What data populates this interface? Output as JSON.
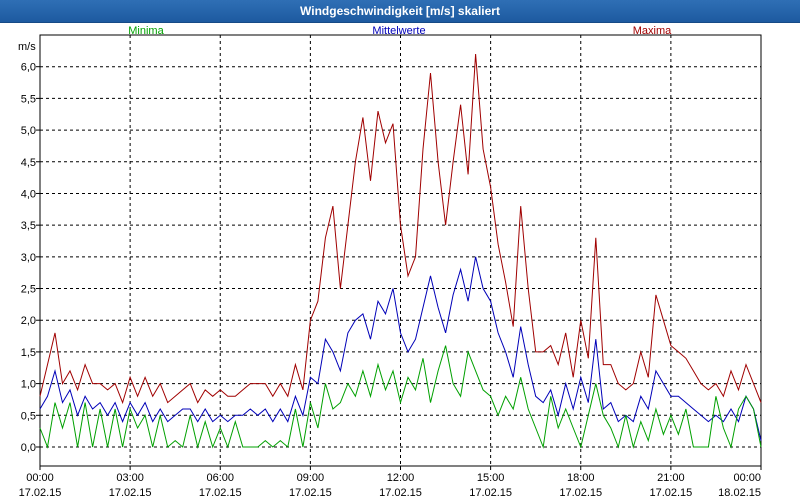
{
  "window": {
    "title": "Windgeschwindigkeit [m/s] skaliert"
  },
  "legend": {
    "min": "Minima",
    "mean": "Mittelwerte",
    "max": "Maxima"
  },
  "colors": {
    "min": "#00a000",
    "mean": "#0000b8",
    "max": "#a00000",
    "titlebar": "#2463a8",
    "grid": "#000000"
  },
  "chart_data": {
    "type": "line",
    "title": "Windgeschwindigkeit [m/s] skaliert",
    "ylabel": "m/s",
    "ylim": [
      -0.3,
      6.5
    ],
    "yticks": [
      "0,0",
      "0,5",
      "1,0",
      "1,5",
      "2,0",
      "2,5",
      "3,0",
      "3,5",
      "4,0",
      "4,5",
      "5,0",
      "5,5",
      "6,0"
    ],
    "xlabels": [
      {
        "time": "00:00",
        "date": "17.02.15"
      },
      {
        "time": "03:00",
        "date": "17.02.15"
      },
      {
        "time": "06:00",
        "date": "17.02.15"
      },
      {
        "time": "09:00",
        "date": "17.02.15"
      },
      {
        "time": "12:00",
        "date": "17.02.15"
      },
      {
        "time": "15:00",
        "date": "17.02.15"
      },
      {
        "time": "18:00",
        "date": "17.02.15"
      },
      {
        "time": "21:00",
        "date": "17.02.15"
      },
      {
        "time": "00:00",
        "date": "18.02.15"
      }
    ],
    "x_hours": [
      0,
      0.25,
      0.5,
      0.75,
      1,
      1.25,
      1.5,
      1.75,
      2,
      2.25,
      2.5,
      2.75,
      3,
      3.25,
      3.5,
      3.75,
      4,
      4.25,
      4.5,
      4.75,
      5,
      5.25,
      5.5,
      5.75,
      6,
      6.25,
      6.5,
      6.75,
      7,
      7.25,
      7.5,
      7.75,
      8,
      8.25,
      8.5,
      8.75,
      9,
      9.25,
      9.5,
      9.75,
      10,
      10.25,
      10.5,
      10.75,
      11,
      11.25,
      11.5,
      11.75,
      12,
      12.25,
      12.5,
      12.75,
      13,
      13.25,
      13.5,
      13.75,
      14,
      14.25,
      14.5,
      14.75,
      15,
      15.25,
      15.5,
      15.75,
      16,
      16.25,
      16.5,
      16.75,
      17,
      17.25,
      17.5,
      17.75,
      18,
      18.25,
      18.5,
      18.75,
      19,
      19.25,
      19.5,
      19.75,
      20,
      20.25,
      20.5,
      20.75,
      21,
      21.25,
      21.5,
      21.75,
      22,
      22.25,
      22.5,
      22.75,
      23,
      23.25,
      23.5,
      23.75,
      24
    ],
    "series": [
      {
        "name": "Maxima",
        "key": "max",
        "values": [
          0.8,
          1.3,
          1.8,
          1.0,
          1.2,
          0.9,
          1.3,
          1.0,
          1.0,
          0.9,
          1.0,
          0.7,
          1.1,
          0.8,
          1.1,
          0.8,
          1.0,
          0.7,
          0.8,
          0.9,
          1.0,
          0.7,
          0.9,
          0.8,
          0.9,
          0.8,
          0.8,
          0.9,
          1.0,
          1.0,
          1.0,
          0.8,
          1.0,
          0.8,
          1.3,
          0.9,
          2.0,
          2.3,
          3.3,
          3.8,
          2.5,
          3.5,
          4.5,
          5.2,
          4.2,
          5.3,
          4.8,
          5.1,
          3.5,
          2.7,
          3.0,
          4.7,
          5.9,
          4.5,
          3.5,
          4.5,
          5.4,
          4.3,
          6.2,
          4.7,
          4.1,
          3.2,
          2.6,
          1.9,
          3.8,
          2.5,
          1.5,
          1.5,
          1.6,
          1.3,
          1.8,
          1.1,
          2.0,
          1.4,
          3.3,
          1.3,
          1.3,
          1.0,
          0.9,
          1.0,
          1.5,
          1.1,
          2.4,
          2.0,
          1.6,
          1.5,
          1.4,
          1.2,
          1.0,
          0.9,
          1.0,
          0.8,
          1.2,
          0.9,
          1.3,
          1.0,
          0.7
        ]
      },
      {
        "name": "Mittelwerte",
        "key": "mean",
        "values": [
          0.6,
          0.8,
          1.2,
          0.7,
          0.9,
          0.5,
          0.8,
          0.6,
          0.7,
          0.5,
          0.7,
          0.4,
          0.7,
          0.5,
          0.7,
          0.4,
          0.6,
          0.4,
          0.5,
          0.6,
          0.6,
          0.4,
          0.6,
          0.4,
          0.5,
          0.4,
          0.5,
          0.5,
          0.6,
          0.5,
          0.6,
          0.4,
          0.6,
          0.4,
          0.8,
          0.5,
          1.1,
          1.0,
          1.7,
          1.5,
          1.2,
          1.8,
          2.0,
          2.1,
          1.7,
          2.3,
          2.1,
          2.5,
          1.8,
          1.5,
          1.7,
          2.2,
          2.7,
          2.2,
          1.8,
          2.4,
          2.8,
          2.3,
          3.0,
          2.5,
          2.3,
          1.8,
          1.5,
          1.1,
          1.9,
          1.3,
          0.8,
          0.7,
          0.9,
          0.5,
          1.0,
          0.6,
          1.1,
          0.7,
          1.7,
          0.6,
          0.7,
          0.4,
          0.5,
          0.4,
          0.8,
          0.6,
          1.2,
          1.0,
          0.8,
          0.8,
          0.7,
          0.6,
          0.5,
          0.4,
          0.5,
          0.4,
          0.6,
          0.4,
          0.8,
          0.6,
          0.1
        ]
      },
      {
        "name": "Minima",
        "key": "min",
        "values": [
          0.3,
          0.0,
          0.7,
          0.3,
          0.7,
          0.0,
          0.7,
          0.0,
          0.6,
          0.0,
          0.6,
          0.0,
          0.6,
          0.3,
          0.5,
          0.0,
          0.5,
          0.0,
          0.1,
          0.0,
          0.5,
          0.0,
          0.4,
          0.0,
          0.3,
          0.0,
          0.4,
          0.0,
          0.0,
          0.0,
          0.1,
          0.0,
          0.1,
          0.0,
          0.6,
          0.0,
          0.7,
          0.3,
          1.0,
          0.6,
          0.7,
          1.0,
          0.8,
          1.2,
          0.8,
          1.3,
          0.9,
          1.2,
          0.7,
          1.1,
          0.9,
          1.4,
          0.7,
          1.2,
          1.6,
          1.0,
          0.8,
          1.5,
          1.2,
          0.9,
          0.8,
          0.5,
          0.8,
          0.6,
          1.1,
          0.6,
          0.3,
          0.0,
          0.8,
          0.3,
          0.6,
          0.3,
          0.0,
          0.5,
          1.0,
          0.5,
          0.3,
          0.0,
          0.5,
          0.0,
          0.4,
          0.1,
          0.6,
          0.2,
          0.5,
          0.2,
          0.6,
          0.0,
          0.0,
          0.0,
          0.8,
          0.3,
          0.0,
          0.6,
          0.8,
          0.6,
          0.0
        ]
      }
    ]
  }
}
